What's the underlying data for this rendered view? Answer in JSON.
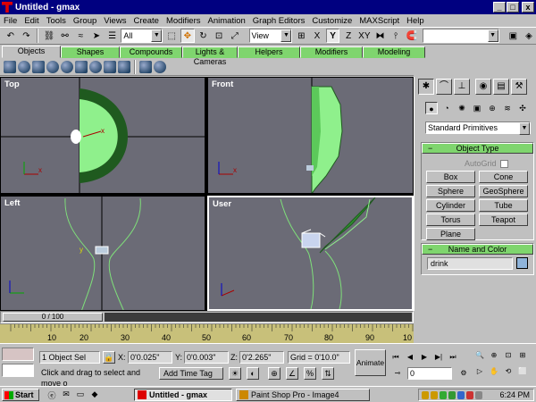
{
  "window": {
    "title": "Untitled - gmax",
    "min": "_",
    "max": "□",
    "close": "x"
  },
  "menu": [
    "File",
    "Edit",
    "Tools",
    "Group",
    "Views",
    "Create",
    "Modifiers",
    "Animation",
    "Graph Editors",
    "Customize",
    "MAXScript",
    "Help"
  ],
  "toolbar": {
    "selection_filter": "All",
    "ref_coord": "View",
    "axis_x": "X",
    "axis_y": "Y",
    "axis_z": "Z",
    "axis_xy": "XY",
    "named_sel": ""
  },
  "tabs": [
    "Objects",
    "Shapes",
    "Compounds",
    "Lights & Cameras",
    "Helpers",
    "Modifiers",
    "Modeling"
  ],
  "viewports": {
    "top": "Top",
    "front": "Front",
    "left": "Left",
    "user": "User"
  },
  "command_panel": {
    "dropdown": "Standard Primitives",
    "object_type_title": "Object Type",
    "autogrid": "AutoGrid",
    "buttons": [
      "Box",
      "Cone",
      "Sphere",
      "GeoSphere",
      "Cylinder",
      "Tube",
      "Torus",
      "Teapot",
      "Plane"
    ],
    "name_color_title": "Name and Color",
    "name_value": "drink",
    "swatch_color": "#8fb4da"
  },
  "timeline": {
    "slider": "0 / 100",
    "ticks": [
      "10",
      "20",
      "30",
      "40",
      "50",
      "60",
      "70",
      "80",
      "90",
      "10"
    ]
  },
  "status": {
    "selection": "1 Object Sel",
    "x_label": "X:",
    "x_value": "0'0.025\"",
    "y_label": "Y:",
    "y_value": "0'0.003\"",
    "z_label": "Z:",
    "z_value": "0'2.265\"",
    "grid": "Grid = 0'10.0\"",
    "prompt": "Click and drag to select and move o",
    "add_time_tag": "Add Time Tag",
    "animate": "Animate",
    "frame": "0"
  },
  "taskbar": {
    "start": "Start",
    "items": [
      "Untitled - gmax",
      "Paint Shop Pro - Image4"
    ],
    "clock": "6:24 PM"
  }
}
